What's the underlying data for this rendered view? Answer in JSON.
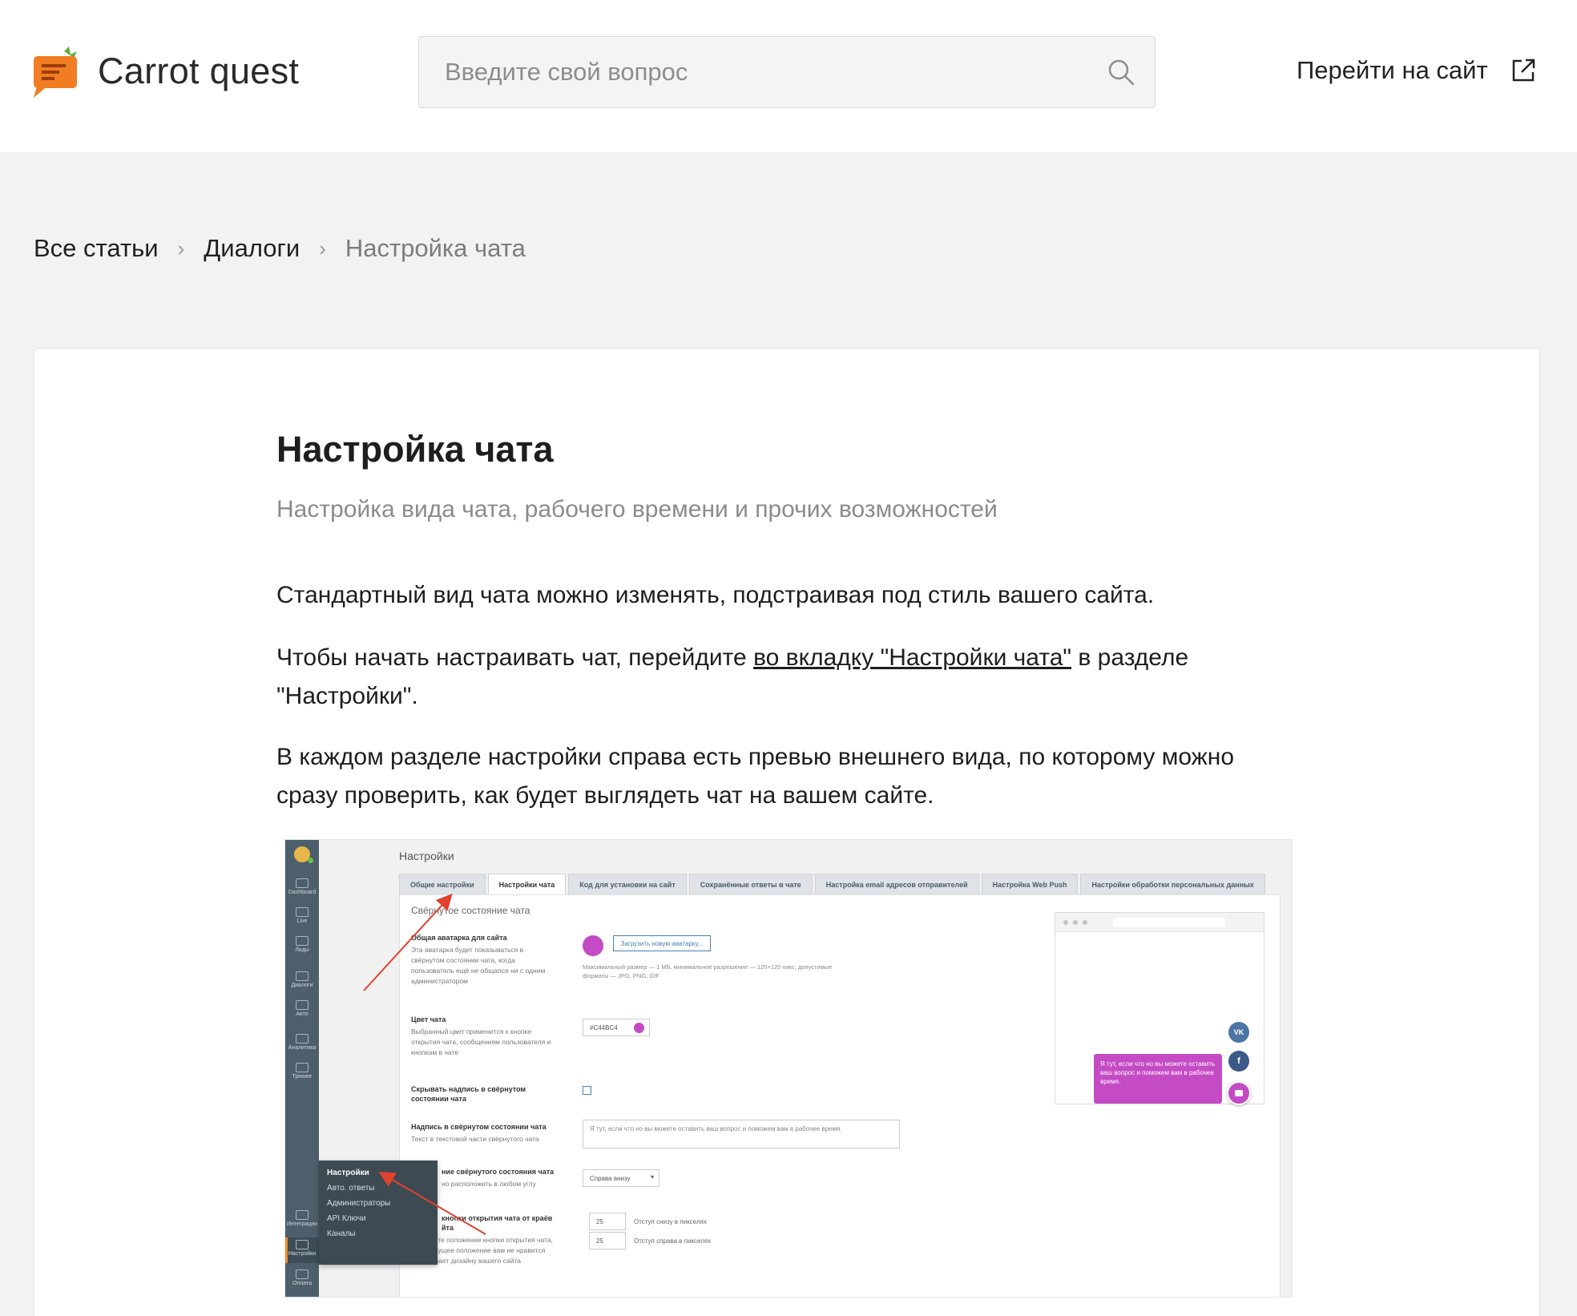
{
  "header": {
    "logo_text": "Carrot quest",
    "search_placeholder": "Введите свой вопрос",
    "goto_label": "Перейти на сайт",
    "brand_color": "#f07c23"
  },
  "breadcrumb": {
    "items": [
      "Все статьи",
      "Диалоги"
    ],
    "current": "Настройка чата"
  },
  "article": {
    "title": "Настройка чата",
    "subtitle": "Настройка вида чата, рабочего времени и прочих возможностей",
    "p1": "Стандартный вид чата можно изменять, подстраивая под стиль вашего сайта.",
    "p2_before": "Чтобы начать настраивать чат, перейдите ",
    "p2_link": "во вкладку \"Настройки чата\"",
    "p2_after": " в разделе \"Настройки\".",
    "p3": "В каждом разделе настройки справа есть превью внешнего вида, по которому можно сразу проверить, как будет выглядеть чат на вашем сайте."
  },
  "screenshot": {
    "heading": "Настройки",
    "tabs": [
      "Общие настройки",
      "Настройки чата",
      "Код для установки на сайт",
      "Сохранённые ответы в чате",
      "Настройка email адресов отправителей",
      "Настройка Web Push",
      "Настройки обработки персональных данных"
    ],
    "section": "Свёрнутое состояние чата",
    "avatar_title": "Общая аватарка для сайта",
    "avatar_desc": "Эта аватарка будет показываться в свёрнутом состоянии чата, когда пользователь ещё не общался ни с одним администратором",
    "upload_label": "Загрузить новую аватарку...",
    "upload_hint": "Максимальный размер — 1 МБ, минимальное разрешение — 120×120 пикс, допустимые форматы — JPG, PNG, GIF",
    "color_title": "Цвет чата",
    "color_desc": "Выбранный цвет применится к кнопке открытия чата, сообщениям пользователя и кнопкам в чате",
    "color_value": "#C44BC4",
    "hide_title": "Скрывать надпись в свёрнутом состоянии чата",
    "label_title": "Надпись в свёрнутом состоянии чата",
    "label_desc": "Текст в текстовой части свёрнутого чата",
    "label_value": "Я тут, если что но вы можете оставить ваш вопрос и поможем вам в рабочее время.",
    "position_title": "ние свёрнутого состояния чата",
    "position_desc": "но расположить в любом углу",
    "position_value": "Справа внизу",
    "offset_title": "кнопки открытия чата от краёв",
    "offset_title2": "йта",
    "offset_desc": "Настройте положение кнопки открытия чата, если текущее положение вам не нравится или мешает дизайну вашего сайта",
    "offset_bottom": "25",
    "offset_bottom_label": "Отступ снизу в пикселях",
    "offset_right": "25",
    "offset_right_label": "Отступ справа в пикселях",
    "bubble_text": "Я тут, если что но вы можете оставить ваш вопрос и поможем вам в рабочее время.",
    "vk_label": "VK",
    "fb_label": "f",
    "sidebar": [
      "Dashboard",
      "Live",
      "Лиды",
      "Диалоги",
      "Авто",
      "Аналитика",
      "Трекинг",
      "Интеграции",
      "Настройки",
      "Оплата"
    ],
    "menu": [
      "Настройки",
      "Авто. ответы",
      "Администраторы",
      "API Ключи",
      "Каналы"
    ],
    "accent_color": "#c44bc4",
    "arrow_color": "#e0412f"
  }
}
